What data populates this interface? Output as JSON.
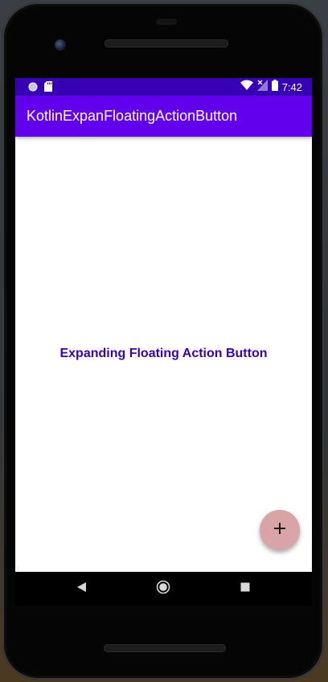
{
  "status_bar": {
    "time": "7:42",
    "background": "#3700b3"
  },
  "app_bar": {
    "title": "KotlinExpanFloatingActionButton",
    "background": "#6200ee"
  },
  "content": {
    "heading": "Expanding Floating Action Button",
    "heading_color": "#3700b3"
  },
  "fab": {
    "icon": "plus-icon",
    "background": "#d9a4a8"
  },
  "navigation": {
    "buttons": [
      "back-icon",
      "home-icon",
      "recents-icon"
    ]
  }
}
